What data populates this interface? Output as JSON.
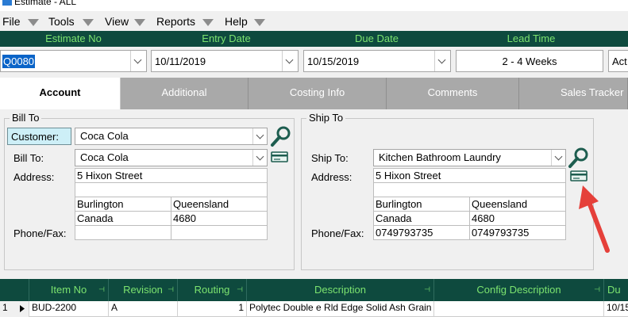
{
  "window": {
    "title": "Estimate - ALL"
  },
  "menu": [
    {
      "label": "File"
    },
    {
      "label": "Tools"
    },
    {
      "label": "View"
    },
    {
      "label": "Reports"
    },
    {
      "label": "Help"
    }
  ],
  "header": {
    "labels": {
      "estimate_no": "Estimate No",
      "entry_date": "Entry Date",
      "due_date": "Due Date",
      "lead_time": "Lead Time"
    },
    "estimate_no": "Q0080",
    "entry_date": "10/11/2019",
    "due_date": "10/15/2019",
    "lead_time": "2 - 4 Weeks",
    "status_partial": "Act"
  },
  "tabs": [
    {
      "label": "Account",
      "active": true
    },
    {
      "label": "Additional"
    },
    {
      "label": "Costing Info"
    },
    {
      "label": "Comments"
    },
    {
      "label": "Sales Tracker"
    }
  ],
  "bill_to": {
    "group_title": "Bill To",
    "customer_label": "Customer:",
    "customer": "Coca Cola",
    "bill_to_label": "Bill To:",
    "bill_to": "Coca Cola",
    "address_label": "Address:",
    "address_line1": "5 Hixon Street",
    "city": "Burlington",
    "state": "Queensland",
    "country": "Canada",
    "postcode": "4680",
    "phone_label": "Phone/Fax:",
    "phone": "",
    "fax": ""
  },
  "ship_to": {
    "group_title": "Ship To",
    "ship_to_label": "Ship To:",
    "ship_to": "Kitchen Bathroom Laundry",
    "address_label": "Address:",
    "address_line1": "5 Hixon Street",
    "city": "Burlington",
    "state": "Queensland",
    "country": "Canada",
    "postcode": "4680",
    "phone_label": "Phone/Fax:",
    "phone": "0749793735",
    "fax": "0749793735"
  },
  "grid": {
    "columns": [
      "Item No",
      "Revision",
      "Routing",
      "Description",
      "Config Description",
      "Du"
    ],
    "rows": [
      {
        "num": "1",
        "item_no": "BUD-2200",
        "revision": "A",
        "routing": "1",
        "description": "Polytec Double e Rld Edge Solid Ash Grain",
        "config": "",
        "due": "10/15/"
      }
    ]
  },
  "colors": {
    "header_bg": "#0e4a3e",
    "header_text": "#7ce36f",
    "tab_inactive": "#a9a9a9",
    "customer_label_bg": "#cdeff7",
    "selection": "#0a64c8",
    "arrow": "#e5403a"
  }
}
